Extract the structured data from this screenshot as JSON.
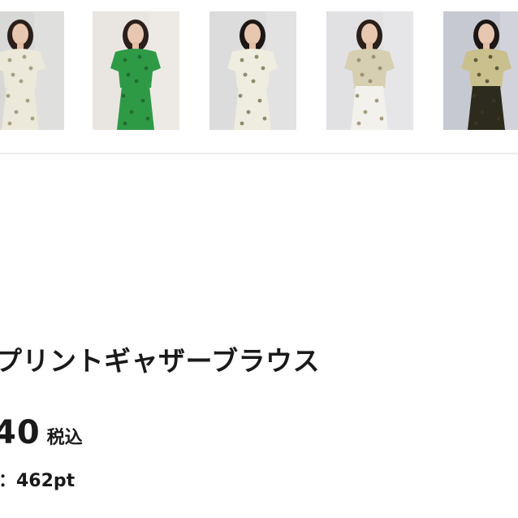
{
  "thumbnails": [
    {
      "label": "",
      "bg": "#d8d8d6",
      "garment": "#ece8da",
      "pattern": "#8c8a66",
      "bottom": "#ece8da",
      "hair": "#2a1f1a"
    },
    {
      "label": "",
      "bg": "#e9e6e1",
      "garment": "#2f9a46",
      "pattern": "#1b5e2b",
      "bottom": "#2f9a46",
      "hair": "#2a1f1a"
    },
    {
      "label": "",
      "bg": "#dcdcdc",
      "garment": "#efece0",
      "pattern": "#6d6a44",
      "bottom": "#efece0",
      "hair": "#1c1614"
    },
    {
      "label": "",
      "bg": "#e1e1e3",
      "garment": "#d7cfb2",
      "pattern": "#8a7f58",
      "bottom": "#f3f1ec",
      "hair": "#2a1f1a"
    },
    {
      "label": "",
      "bg": "#c7c9d2",
      "garment": "#c9c08d",
      "pattern": "#3e3a22",
      "bottom": "#2d2a1e",
      "hair": "#1c1614"
    }
  ],
  "product": {
    "name": "プリントギャザーブラウス",
    "price": "40",
    "tax_label": "税込",
    "points": "：462pt"
  }
}
